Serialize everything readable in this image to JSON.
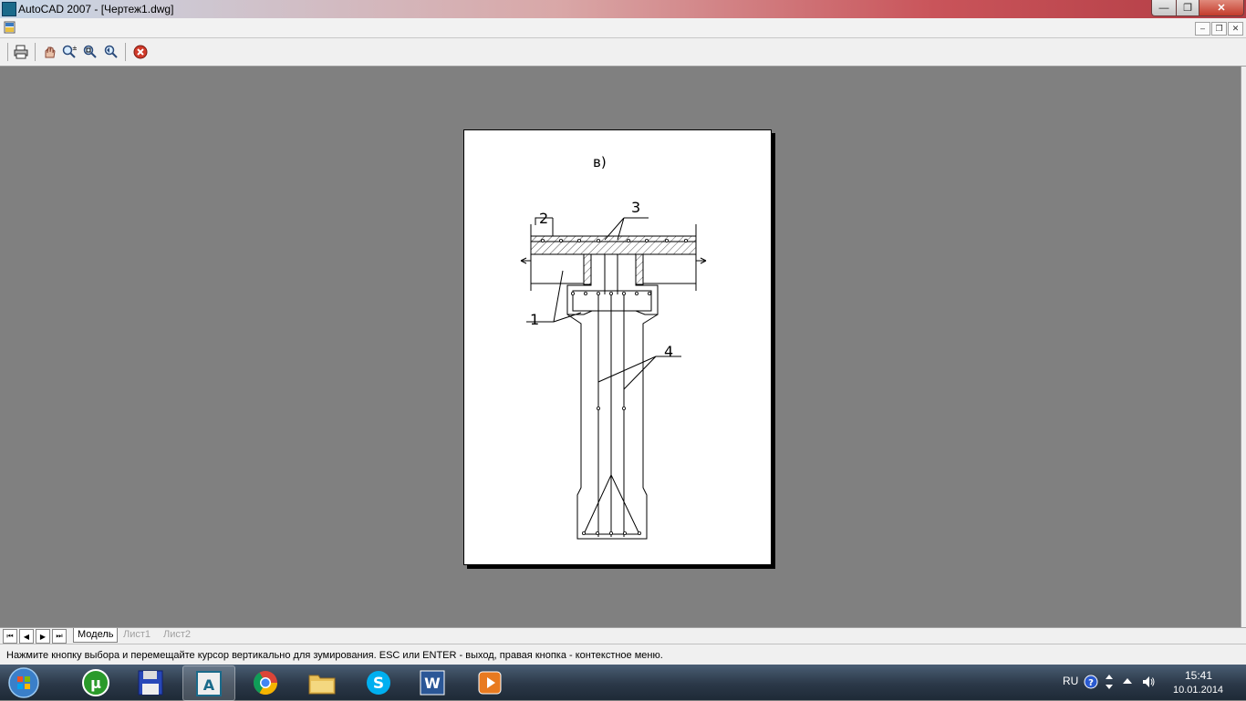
{
  "window": {
    "title": "AutoCAD 2007 - [Чертеж1.dwg]",
    "min_glyph": "—",
    "max_glyph": "❐",
    "close_glyph": "✕"
  },
  "mdi": {
    "min_glyph": "–",
    "restore_glyph": "❐",
    "close_glyph": "✕"
  },
  "toolbar": {
    "buttons": [
      "print-icon",
      "pan-icon",
      "zoom-realtime-icon",
      "zoom-window-icon",
      "zoom-previous-icon",
      "close-preview-icon"
    ]
  },
  "drawing": {
    "caption": "в)",
    "callouts": [
      "1",
      "2",
      "3",
      "4"
    ]
  },
  "tabs": {
    "nav": [
      "⏮",
      "◀",
      "▶",
      "⏭"
    ],
    "items": [
      {
        "label": "Модель",
        "active": true
      },
      {
        "label": "Лист1",
        "active": false
      },
      {
        "label": "Лист2",
        "active": false
      }
    ]
  },
  "status": {
    "message": "Нажмите кнопку выбора и перемещайте курсор вертикально для зумирования. ESC или ENTER - выход, правая кнопка - контекстное меню."
  },
  "taskbar": {
    "apps": [
      "utorrent-icon",
      "floppy-icon",
      "autocad-icon",
      "chrome-icon",
      "explorer-icon",
      "skype-icon",
      "word-icon",
      "media-player-icon"
    ],
    "lang": "RU",
    "time": "15:41",
    "date": "10.01.2014"
  },
  "colors": {
    "canvas_bg": "#808080",
    "sheet": "#ffffff",
    "close_red": "#c43b2b"
  }
}
